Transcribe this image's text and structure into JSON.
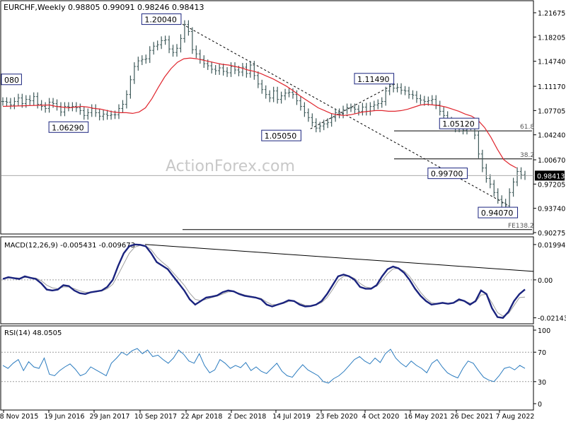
{
  "header": {
    "symbol": "EURCHF,Weekly",
    "ohlc": "0.98805 0.99091 0.98246 0.98413"
  },
  "watermark": "ActionForex.com",
  "colors": {
    "price": "#3f5a5a",
    "ma": "#e0262e",
    "macd": "#1a237e",
    "signal": "#9e9e9e",
    "rsi": "#2a7bbf",
    "trend": "#000000",
    "label_border": "#1a237e",
    "grid": "#9e9e9e"
  },
  "chart_data": [
    {
      "type": "line",
      "panel": "price",
      "ylim": [
        0.9,
        1.234
      ],
      "y_ticks": [
        "1.21675",
        "1.18205",
        "1.14740",
        "1.11170",
        "1.07705",
        "1.04240",
        "1.00670",
        "0.97205",
        "0.93740",
        "0.90275"
      ],
      "x_ticks": [
        "8 Nov 2015",
        "19 Jun 2016",
        "29 Jan 2017",
        "10 Sep 2017",
        "22 Apr 2018",
        "2 Dec 2018",
        "14 Jul 2019",
        "23 Feb 2020",
        "4 Oct 2020",
        "16 May 2021",
        "26 Dec 2021",
        "7 Aug 2022"
      ],
      "current_price": "0.98413",
      "series": [
        {
          "name": "",
          "style": "bars",
          "values": [
            1.09,
            1.089,
            1.085,
            1.09,
            1.095,
            1.087,
            1.093,
            1.091,
            1.097,
            1.086,
            1.083,
            1.08,
            1.089,
            1.087,
            1.083,
            1.075,
            1.083,
            1.082,
            1.083,
            1.081,
            1.077,
            1.07,
            1.074,
            1.08,
            1.074,
            1.069,
            1.072,
            1.07,
            1.071,
            1.071,
            1.08,
            1.086,
            1.1,
            1.121,
            1.14,
            1.148,
            1.15,
            1.151,
            1.163,
            1.169,
            1.171,
            1.177,
            1.178,
            1.165,
            1.16,
            1.166,
            1.18,
            1.2,
            1.19,
            1.164,
            1.158,
            1.15,
            1.144,
            1.141,
            1.136,
            1.134,
            1.138,
            1.133,
            1.131,
            1.14,
            1.135,
            1.132,
            1.139,
            1.13,
            1.142,
            1.127,
            1.115,
            1.107,
            1.1,
            1.095,
            1.105,
            1.093,
            1.098,
            1.102,
            1.103,
            1.1,
            1.091,
            1.083,
            1.074,
            1.067,
            1.06,
            1.052,
            1.055,
            1.058,
            1.06,
            1.067,
            1.074,
            1.072,
            1.078,
            1.081,
            1.081,
            1.079,
            1.076,
            1.082,
            1.076,
            1.083,
            1.085,
            1.087,
            1.09,
            1.105,
            1.114,
            1.109,
            1.11,
            1.106,
            1.105,
            1.1,
            1.099,
            1.094,
            1.092,
            1.09,
            1.091,
            1.093,
            1.085,
            1.076,
            1.07,
            1.062,
            1.059,
            1.052,
            1.057,
            1.049,
            1.055,
            1.06,
            1.042,
            1.015,
            0.995,
            0.98,
            0.972,
            0.96,
            0.95,
            0.945,
            0.941,
            0.96,
            0.975,
            0.99,
            0.985,
            0.984
          ]
        },
        {
          "name": "",
          "style": "line",
          "values": [
            1.085,
            1.083,
            1.082,
            1.081,
            1.082,
            1.083,
            1.082,
            1.08,
            1.079,
            1.077,
            1.075,
            1.074,
            1.074,
            1.073,
            1.075,
            1.081,
            1.094,
            1.11,
            1.125,
            1.137,
            1.146,
            1.151,
            1.152,
            1.151,
            1.149,
            1.147,
            1.145,
            1.143,
            1.142,
            1.14,
            1.138,
            1.135,
            1.133,
            1.13,
            1.126,
            1.122,
            1.117,
            1.112,
            1.106,
            1.099,
            1.093,
            1.087,
            1.081,
            1.077,
            1.073,
            1.071,
            1.07,
            1.071,
            1.073,
            1.075,
            1.076,
            1.077,
            1.077,
            1.076,
            1.076,
            1.077,
            1.079,
            1.082,
            1.085,
            1.086,
            1.085,
            1.084,
            1.082,
            1.079,
            1.076,
            1.072,
            1.069,
            1.063,
            1.053,
            1.039,
            1.022,
            1.007,
            1.0,
            0.995
          ]
        }
      ],
      "annotations": [
        {
          "text": "1.20040",
          "x": 41,
          "y": 1.2
        },
        {
          "text": "1.06290",
          "x": 17,
          "y": 1.063
        },
        {
          "text": "1.05050",
          "x": 72,
          "y": 1.051
        },
        {
          "text": "1.11490",
          "x": 96,
          "y": 1.115
        },
        {
          "text": "1.05120",
          "x": 118,
          "y": 1.051
        },
        {
          "text": "0.99700",
          "x": 115,
          "y": 0.997
        },
        {
          "text": "0.94070",
          "x": 128,
          "y": 0.941
        },
        {
          "text": "080",
          "x": 0,
          "y": 1.114
        }
      ],
      "levels": [
        {
          "text": "61.8",
          "y": 1.048
        },
        {
          "text": "38.2",
          "y": 1.008
        },
        {
          "text": "FE138.2",
          "y": 0.907
        }
      ]
    },
    {
      "type": "line",
      "panel": "macd",
      "title": "MACD(12,26,9) -0.005431 -0.009673",
      "ylim": [
        -0.026,
        0.022
      ],
      "y_ticks": [
        "0.019943",
        "0.00",
        "-0.021434"
      ],
      "series": [
        {
          "name": "",
          "values": [
            0.0005,
            0.0015,
            0.001,
            0.0005,
            0.002,
            0.0012,
            0.0005,
            -0.002,
            -0.0055,
            -0.006,
            -0.0055,
            -0.003,
            -0.0035,
            -0.006,
            -0.0075,
            -0.008,
            -0.007,
            -0.0065,
            -0.006,
            -0.004,
            0.0,
            0.008,
            0.015,
            0.019,
            0.02,
            0.0198,
            0.019,
            0.015,
            0.01,
            0.008,
            0.006,
            0.002,
            -0.002,
            -0.006,
            -0.011,
            -0.014,
            -0.012,
            -0.01,
            -0.0095,
            -0.0088,
            -0.007,
            -0.006,
            -0.0065,
            -0.008,
            -0.009,
            -0.0095,
            -0.01,
            -0.011,
            -0.014,
            -0.015,
            -0.014,
            -0.013,
            -0.0115,
            -0.012,
            -0.014,
            -0.015,
            -0.0148,
            -0.014,
            -0.012,
            -0.008,
            -0.003,
            0.002,
            0.003,
            0.002,
            0.0,
            -0.004,
            -0.005,
            -0.005,
            -0.003,
            0.002,
            0.006,
            0.0075,
            0.0065,
            0.004,
            0.0,
            -0.005,
            -0.009,
            -0.012,
            -0.014,
            -0.0135,
            -0.013,
            -0.0135,
            -0.013,
            -0.011,
            -0.012,
            -0.014,
            -0.012,
            -0.006,
            -0.008,
            -0.016,
            -0.021,
            -0.0215,
            -0.018,
            -0.012,
            -0.008,
            -0.0054
          ]
        },
        {
          "name": "",
          "values": [
            0.0008,
            0.001,
            0.0012,
            0.001,
            0.0014,
            0.0013,
            0.001,
            -0.0005,
            -0.003,
            -0.0045,
            -0.005,
            -0.004,
            -0.004,
            -0.005,
            -0.0062,
            -0.007,
            -0.007,
            -0.0067,
            -0.0063,
            -0.005,
            -0.0025,
            0.003,
            0.009,
            0.015,
            0.0185,
            0.0195,
            0.0192,
            0.017,
            0.013,
            0.01,
            0.0075,
            0.004,
            0.0005,
            -0.003,
            -0.0075,
            -0.011,
            -0.0118,
            -0.011,
            -0.01,
            -0.0092,
            -0.008,
            -0.0068,
            -0.0066,
            -0.0075,
            -0.0085,
            -0.0092,
            -0.0098,
            -0.0105,
            -0.0125,
            -0.014,
            -0.014,
            -0.0134,
            -0.0122,
            -0.012,
            -0.0132,
            -0.0144,
            -0.0146,
            -0.0142,
            -0.0128,
            -0.01,
            -0.0055,
            -0.0005,
            0.002,
            0.0022,
            0.0008,
            -0.002,
            -0.004,
            -0.0046,
            -0.0036,
            -0.0005,
            0.0035,
            0.0062,
            0.0065,
            0.005,
            0.002,
            -0.0025,
            -0.007,
            -0.0105,
            -0.013,
            -0.0133,
            -0.0131,
            -0.0133,
            -0.0131,
            -0.0118,
            -0.0119,
            -0.0132,
            -0.0125,
            -0.0085,
            -0.0082,
            -0.013,
            -0.0185,
            -0.0205,
            -0.019,
            -0.0145,
            -0.01,
            -0.0097
          ]
        }
      ]
    },
    {
      "type": "line",
      "panel": "rsi",
      "title": "RSI(14) 48.0505",
      "ylim": [
        0,
        100
      ],
      "y_ticks": [
        "100",
        "70",
        "30",
        "0"
      ],
      "series": [
        {
          "name": "",
          "values": [
            52,
            48,
            55,
            60,
            45,
            57,
            50,
            48,
            62,
            40,
            38,
            45,
            50,
            54,
            47,
            38,
            41,
            50,
            46,
            42,
            38,
            55,
            62,
            70,
            66,
            72,
            75,
            68,
            73,
            64,
            66,
            60,
            55,
            62,
            73,
            67,
            58,
            55,
            68,
            52,
            42,
            46,
            60,
            55,
            48,
            52,
            49,
            56,
            45,
            50,
            44,
            41,
            48,
            55,
            44,
            38,
            36,
            45,
            53,
            46,
            42,
            38,
            30,
            28,
            34,
            38,
            44,
            52,
            60,
            64,
            58,
            54,
            62,
            56,
            68,
            74,
            62,
            55,
            50,
            58,
            52,
            48,
            42,
            55,
            60,
            50,
            42,
            38,
            35,
            48,
            58,
            55,
            45,
            36,
            32,
            30,
            38,
            48,
            50,
            46,
            52,
            48
          ]
        }
      ]
    }
  ]
}
